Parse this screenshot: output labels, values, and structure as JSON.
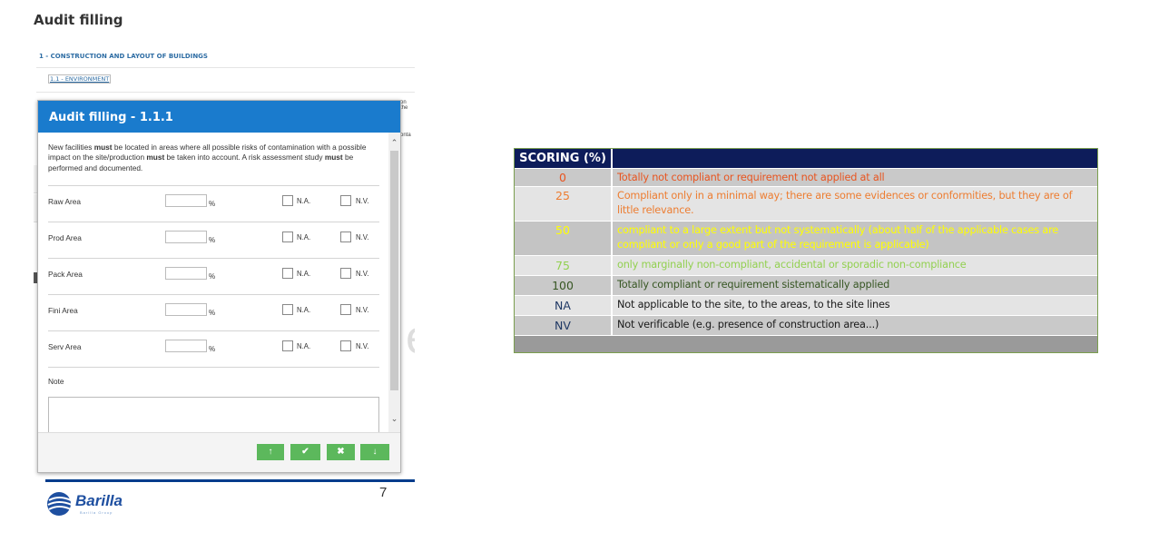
{
  "page": {
    "heading": "Audit filling",
    "page_number": "7"
  },
  "document": {
    "section_title": "1 - CONSTRUCTION AND LAYOUT OF BUILDINGS",
    "subsection": "1.1 - ENVIRONMENT",
    "peek_text_1": "on the",
    "peek_text_2": "onta"
  },
  "modal": {
    "title": "Audit filling - 1.1.1",
    "description_parts": [
      "New facilities ",
      "must",
      " be located in areas where all possible risks of contamination with a possible impact on the site/production ",
      "must",
      " be taken into account. A risk assessment study ",
      "must",
      " be performed and documented."
    ],
    "percent_sign": "%",
    "na_label": "N.A.",
    "nv_label": "N.V.",
    "areas": [
      "Raw Area",
      "Prod Area",
      "Pack Area",
      "Fini Area",
      "Serv Area"
    ],
    "note_label": "Note",
    "footer_buttons": [
      {
        "name": "move-up-button",
        "icon": "arrow-up-icon",
        "glyph": "↑"
      },
      {
        "name": "confirm-button",
        "icon": "check-icon",
        "glyph": "✔"
      },
      {
        "name": "cancel-button",
        "icon": "close-icon",
        "glyph": "✖"
      },
      {
        "name": "move-down-button",
        "icon": "arrow-down-icon",
        "glyph": "↓"
      }
    ],
    "button_color": "#5cb85c",
    "header_color": "#1a7bcd"
  },
  "brand": {
    "logo_text": "Barilla",
    "logo_tagline": "Barilla Group",
    "bar_color": "#003c8c"
  },
  "scoring": {
    "header": "SCORING (%)",
    "rows": [
      {
        "code": "0",
        "text": "Totally not compliant or requirement not applied at all",
        "code_color": "#e8541f",
        "text_color": "#e8541f",
        "bg": "#c9c9c9"
      },
      {
        "code": "25",
        "text": "Compliant only in a minimal way; there are some evidences or conformities, but they are of little relevance.",
        "code_color": "#ed7d31",
        "text_color": "#ed7d31",
        "bg": "#e4e4e4"
      },
      {
        "code": "50",
        "text": "compliant to a large extent but not systematically (about half of the applicable cases are compliant or only a good part of the requirement is applicable)",
        "code_color": "#ffff00",
        "text_color": "#ffff00",
        "bg": "#c4c4c4"
      },
      {
        "code": "75",
        "text": "only marginally non-compliant, accidental or sporadic non-compliance",
        "code_color": "#92d050",
        "text_color": "#92d050",
        "bg": "#e4e4e4"
      },
      {
        "code": "100",
        "text": "Totally compliant or requirement sistematically applied",
        "code_color": "#375623",
        "text_color": "#375623",
        "bg": "#c9c9c9"
      },
      {
        "code": "NA",
        "text": "Not applicable to the site, to the areas, to the site lines",
        "code_color": "#1f3864",
        "text_color": "#1a1a1a",
        "bg": "#e4e4e4"
      },
      {
        "code": "NV",
        "text": "Not verificable (e.g. presence of construction area...)",
        "code_color": "#1f3864",
        "text_color": "#1a1a1a",
        "bg": "#c9c9c9"
      }
    ]
  }
}
